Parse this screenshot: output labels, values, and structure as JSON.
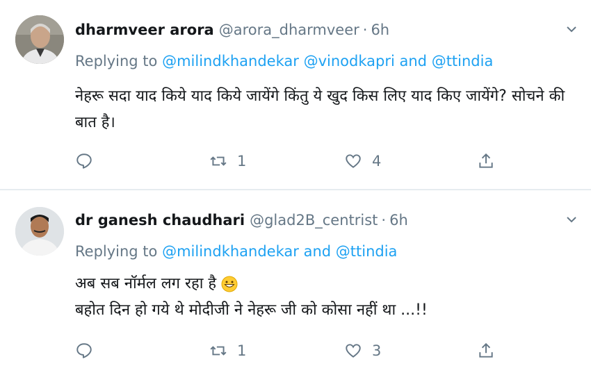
{
  "tweets": [
    {
      "name": "dharmveer arora",
      "handle": "@arora_dharmveer",
      "dot": "·",
      "time": "6h",
      "replying_prefix": "Replying to",
      "mention1": "@milindkhandekar",
      "mention2": "@vinodkapri",
      "and": "and",
      "mention3": "@ttindia",
      "body_line1": "नेहरू सदा याद किये याद किये जायेंगे किंतु ये खुद किस लिए याद किए जायेंगे? सोचने की",
      "body_line2": "बात है।",
      "retweets": "1",
      "likes": "4"
    },
    {
      "name": "dr ganesh chaudhari",
      "handle": "@glad2B_centrist",
      "dot": "·",
      "time": "6h",
      "replying_prefix": "Replying to",
      "mention1": "@milindkhandekar",
      "and": "and",
      "mention2": "@ttindia",
      "body_line1": "अब सब नॉर्मल लग रहा है",
      "body_line2": "बहोत दिन हो गये थे मोदीजी ने नेहरू जी को कोसा नहीं था ...!!",
      "retweets": "1",
      "likes": "3"
    }
  ],
  "icons": {
    "reply": "reply-icon",
    "retweet": "retweet-icon",
    "like": "heart-icon",
    "share": "share-icon",
    "more": "chevron-down-icon",
    "emoji": "grinning-face-emoji-icon"
  },
  "colors": {
    "link": "#1da1f2",
    "muted": "#657786",
    "text": "#14171a",
    "divider": "#e6ecf0"
  }
}
